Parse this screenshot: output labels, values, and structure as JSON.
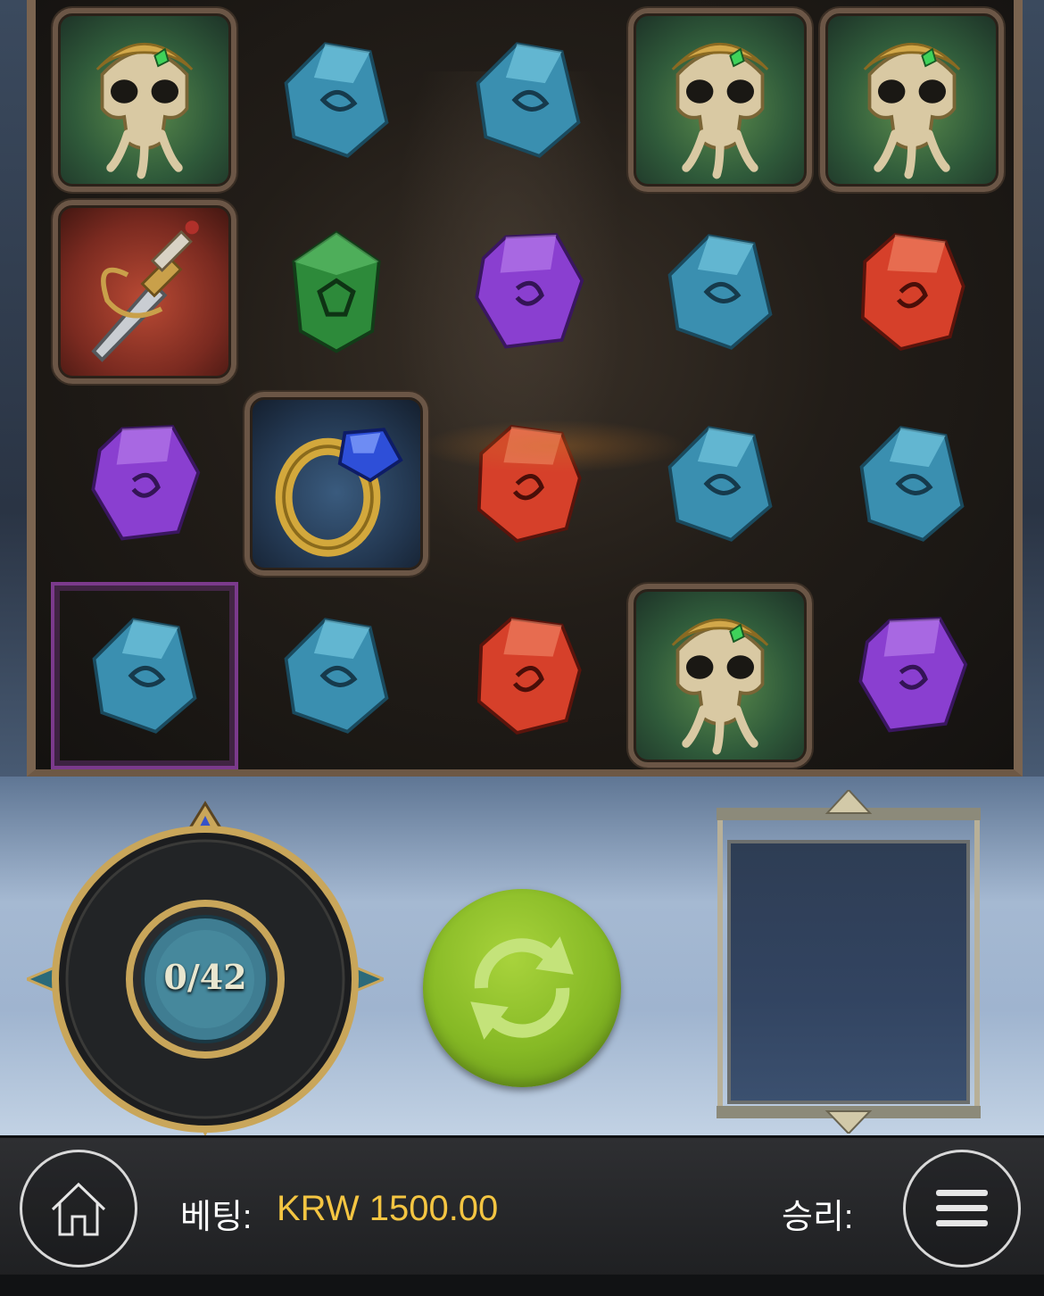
{
  "grid": {
    "columns": 5,
    "rows": 4,
    "symbols": [
      [
        "skull",
        "gem-teal",
        "gem-teal",
        "skull",
        "skull"
      ],
      [
        "dagger",
        "gem-green",
        "gem-purple",
        "gem-teal",
        "gem-red"
      ],
      [
        "gem-purple",
        "ring",
        "gem-red",
        "gem-teal",
        "gem-teal"
      ],
      [
        "gem-teal",
        "gem-teal",
        "gem-red",
        "skull",
        "gem-purple"
      ]
    ],
    "highlighted_cell": {
      "row": 4,
      "column": 1
    }
  },
  "meter": {
    "counter": "0/42"
  },
  "bottom_bar": {
    "bet_label": "베팅:",
    "bet_value": "KRW 1500.00",
    "win_label": "승리:"
  },
  "colors": {
    "bet_value": "#f4c542",
    "spin_button": "#86b925",
    "highlight_frame": "#7b3a8c"
  },
  "icons": [
    "home-icon",
    "menu-icon",
    "spin-icon"
  ]
}
